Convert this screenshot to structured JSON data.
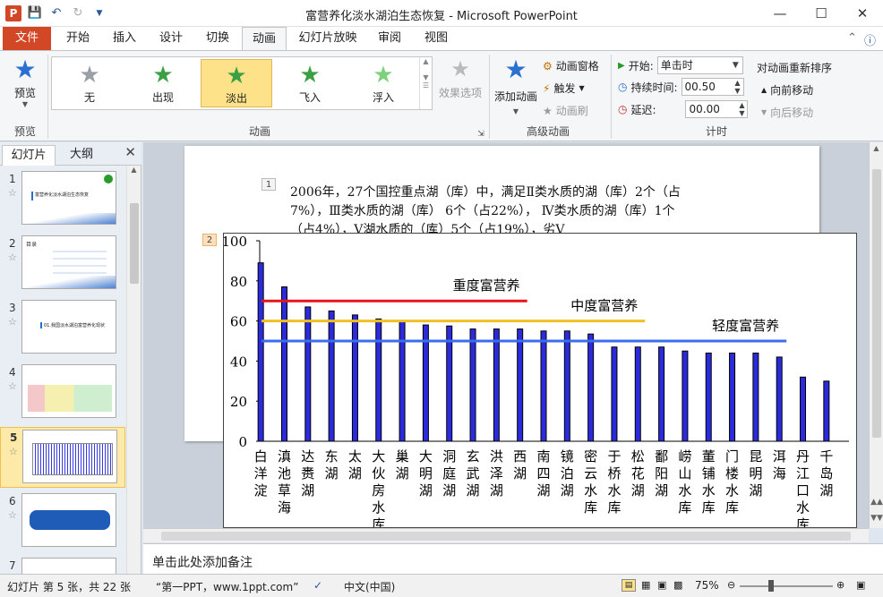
{
  "window": {
    "title": "富营养化淡水湖泊生态恢复  -  Microsoft PowerPoint",
    "app_icon": "P",
    "qat_icons": [
      "save-icon",
      "undo-icon",
      "redo-icon",
      "customize-qat-icon"
    ]
  },
  "tabs": {
    "file": "文件",
    "items": [
      "开始",
      "插入",
      "设计",
      "切换",
      "动画",
      "幻灯片放映",
      "审阅",
      "视图"
    ],
    "active": "动画"
  },
  "ribbon": {
    "preview": {
      "label": "预览",
      "group": "预览"
    },
    "animation_gallery": {
      "group": "动画",
      "items": [
        {
          "label": "无",
          "color": "#9aa0a6"
        },
        {
          "label": "出现",
          "color": "#3aa043"
        },
        {
          "label": "淡出",
          "color": "#3aa043"
        },
        {
          "label": "飞入",
          "color": "#3aa043"
        },
        {
          "label": "浮入",
          "color": "#7ed07e"
        }
      ],
      "selected": "淡出",
      "effect_options": "效果选项"
    },
    "advanced": {
      "group": "高级动画",
      "add_animation": "添加动画",
      "pane": "动画窗格",
      "trigger": "触发",
      "painter": "动画刷"
    },
    "timing": {
      "group": "计时",
      "start_label": "开始:",
      "start_value": "单击时",
      "duration_label": "持续时间:",
      "duration_value": "00.50",
      "delay_label": "延迟:",
      "delay_value": "00.00"
    },
    "reorder": {
      "title": "对动画重新排序",
      "move_earlier": "向前移动",
      "move_later": "向后移动"
    }
  },
  "left_pane": {
    "tab_slides": "幻灯片",
    "tab_outline": "大纲",
    "slides": [
      {
        "num": "1",
        "text": "富营养化淡水湖泊生态恢复"
      },
      {
        "num": "2",
        "text": "目录"
      },
      {
        "num": "3",
        "text": "01.我国淡水湖泊富营养化现状"
      },
      {
        "num": "4",
        "text": ""
      },
      {
        "num": "5",
        "text": ""
      },
      {
        "num": "6",
        "text": ""
      },
      {
        "num": "7",
        "text": ""
      }
    ],
    "selected_num": "5"
  },
  "slide": {
    "tag1": "1",
    "tag2": "2",
    "text": "2006年，27个国控重点湖（库）中，满足Ⅱ类水质的湖（库）2个（占7%），Ⅲ类水质的湖（库） 6个（占22%）， Ⅳ类水质的湖（库）1个（占4%），Ⅴ湖水质的（库）5个（占19%），劣Ⅴ"
  },
  "chart_data": {
    "type": "bar",
    "categories": [
      "白洋淀",
      "滇池草海",
      "达赉湖",
      "东湖",
      "太湖",
      "大伙房水库",
      "巢湖",
      "大明湖",
      "洞庭湖",
      "玄武湖",
      "洪泽湖",
      "西湖",
      "南四湖",
      "镜泊湖",
      "密云水库",
      "于桥水库",
      "松花湖",
      "鄱阳湖",
      "崂山水库",
      "董铺水库",
      "门楼水库",
      "昆明湖",
      "洱海",
      "丹江口水库",
      "千岛湖"
    ],
    "values": [
      89,
      77,
      67,
      65,
      63,
      61,
      60,
      58,
      57.5,
      56,
      56,
      56,
      55,
      55,
      53.5,
      47,
      47,
      47,
      45,
      44,
      44,
      44,
      42,
      32,
      30
    ],
    "ylim": [
      0,
      100
    ],
    "yticks": [
      "100",
      "80",
      "60",
      "40",
      "20",
      "0"
    ],
    "bar_color": "#2b2bdb",
    "lines": [
      {
        "name": "重度富营养",
        "y": 70,
        "x_end_index": 11,
        "color": "#e8141c"
      },
      {
        "name": "中度富营养",
        "y": 60,
        "x_end_index": 16,
        "color": "#f0c020"
      },
      {
        "name": "轻度富营养",
        "y": 50,
        "x_end_index": 22,
        "color": "#3a6df0"
      }
    ]
  },
  "notes": {
    "placeholder": "单击此处添加备注"
  },
  "status_bar": {
    "slide_info": "幻灯片 第 5 张，共 22 张",
    "theme": "“第一PPT，www.1ppt.com”",
    "language": "中文(中国)",
    "zoom": "75%"
  }
}
